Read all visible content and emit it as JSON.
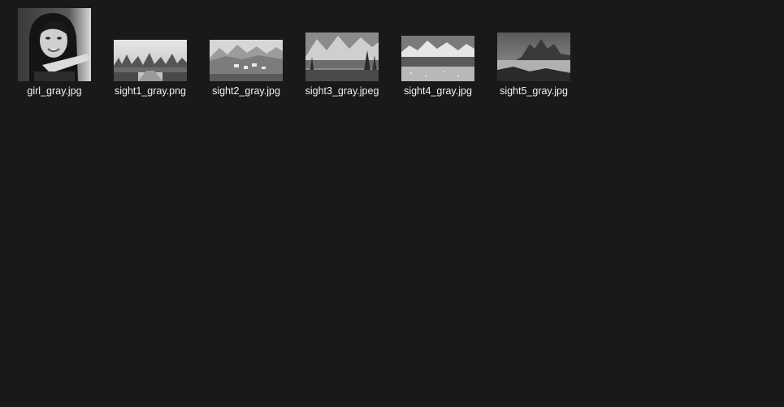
{
  "files": [
    {
      "name": "girl_gray.jpg",
      "thumbnail": "portrait-photo-grayscale"
    },
    {
      "name": "sight1_gray.png",
      "thumbnail": "river-karst-landscape-grayscale"
    },
    {
      "name": "sight2_gray.jpg",
      "thumbnail": "alpine-village-landscape-grayscale"
    },
    {
      "name": "sight3_gray.jpeg",
      "thumbnail": "mountain-lake-forest-grayscale"
    },
    {
      "name": "sight4_gray.jpg",
      "thumbnail": "snowy-peaks-meadow-grayscale"
    },
    {
      "name": "sight5_gray.jpg",
      "thumbnail": "rocky-coast-dusk-grayscale"
    }
  ],
  "colors": {
    "background": "#191919",
    "label": "#f2f2f2"
  }
}
